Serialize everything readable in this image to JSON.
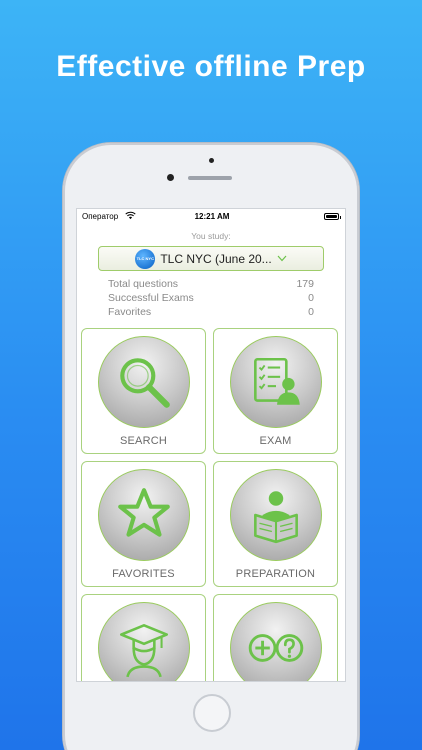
{
  "promo": {
    "headline": "Effective offline Prep"
  },
  "status_bar": {
    "carrier": "Оператор",
    "time": "12:21 AM"
  },
  "study": {
    "label": "You study:",
    "selected_exam": "TLC NYC (June 20...",
    "logo_text": "TLC NYC"
  },
  "stats": [
    {
      "label": "Total questions",
      "value": "179"
    },
    {
      "label": "Successful Exams",
      "value": "0"
    },
    {
      "label": "Favorites",
      "value": "0"
    }
  ],
  "tiles": [
    {
      "label": "SEARCH",
      "icon": "search-icon"
    },
    {
      "label": "EXAM",
      "icon": "exam-icon"
    },
    {
      "label": "FAVORITES",
      "icon": "star-icon"
    },
    {
      "label": "PREPARATION",
      "icon": "reading-icon"
    },
    {
      "label": "",
      "icon": "graduate-icon"
    },
    {
      "label": "",
      "icon": "plus-question-icon"
    }
  ],
  "colors": {
    "accent_green": "#6cc24a",
    "tile_border": "#a9d27f",
    "background_blue": "#2a8df2"
  }
}
